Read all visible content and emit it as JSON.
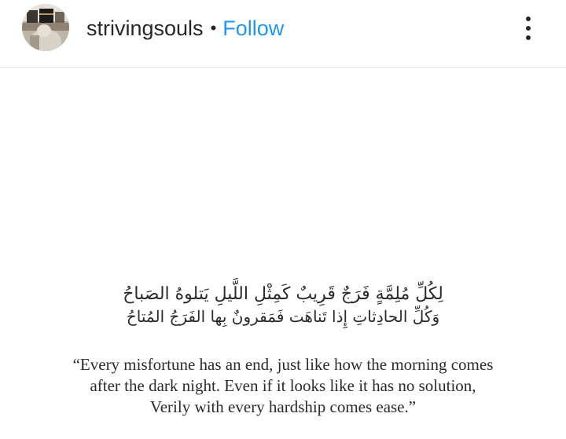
{
  "header": {
    "avatar_icon": "profile-photo-kaaba",
    "username": "strivingsouls",
    "separator": "•",
    "follow_label": "Follow",
    "follow_color": "#1f96f3",
    "more_icon": "vertical-ellipsis-icon"
  },
  "post": {
    "arabic_lines": [
      "لِكُلِّ مُلِمَّةٍ فَرَجٌ قَرِيبٌ كَمِثْلِ اللَّيلِ يَتلوهُ الصَباحُ",
      "وَكُلِّ الحادِثاتِ إِذا تَناهَت فَمَقرونٌ بِها الفَرَجُ المُتاحُ"
    ],
    "translation_lines": [
      "“Every misfortune has an end, just like how the morning comes",
      "after the dark night. Even if it looks like it has no solution,",
      "Verily with every hardship comes ease.”"
    ]
  }
}
